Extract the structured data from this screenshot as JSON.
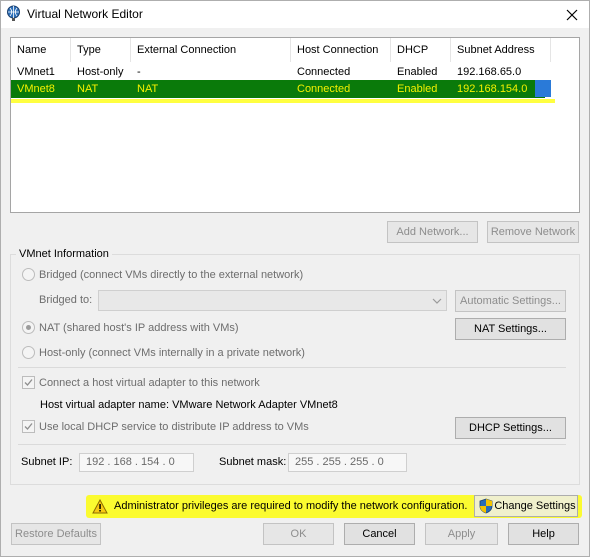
{
  "window": {
    "title": "Virtual Network Editor"
  },
  "table": {
    "columns": [
      "Name",
      "Type",
      "External Connection",
      "Host Connection",
      "DHCP",
      "Subnet Address"
    ],
    "rows": [
      [
        "VMnet1",
        "Host-only",
        "-",
        "Connected",
        "Enabled",
        "192.168.65.0"
      ],
      [
        "VMnet8",
        "NAT",
        "NAT",
        "Connected",
        "Enabled",
        "192.168.154.0"
      ]
    ],
    "selected_row": 1
  },
  "list_buttons": {
    "add": "Add Network...",
    "remove": "Remove Network"
  },
  "vmnet_info": {
    "title": "VMnet Information",
    "bridged_label": "Bridged (connect VMs directly to the external network)",
    "bridged_to_label": "Bridged to:",
    "bridged_to_value": "",
    "auto_settings": "Automatic Settings...",
    "nat_label": "NAT (shared host's IP address with VMs)",
    "nat_settings": "NAT Settings...",
    "hostonly_label": "Host-only (connect VMs internally in a private network)",
    "connect_adapter_label": "Connect a host virtual adapter to this network",
    "adapter_name_text": "Host virtual adapter name: VMware Network Adapter VMnet8",
    "dhcp_label": "Use local DHCP service to distribute IP address to VMs",
    "dhcp_settings": "DHCP Settings...",
    "subnet_ip_label": "Subnet IP:",
    "subnet_ip": "192 . 168 . 154 .  0",
    "subnet_mask_label": "Subnet mask:",
    "subnet_mask": "255 . 255 . 255 .  0"
  },
  "warning": {
    "text": "Administrator privileges are required to modify the network configuration.",
    "change_settings": "Change Settings"
  },
  "footer": {
    "restore": "Restore Defaults",
    "ok": "OK",
    "cancel": "Cancel",
    "apply": "Apply",
    "help": "Help"
  },
  "colors": {
    "selection_bg": "#0a7a0a",
    "selection_text": "#f4f100",
    "highlight": "#fbfb30"
  }
}
